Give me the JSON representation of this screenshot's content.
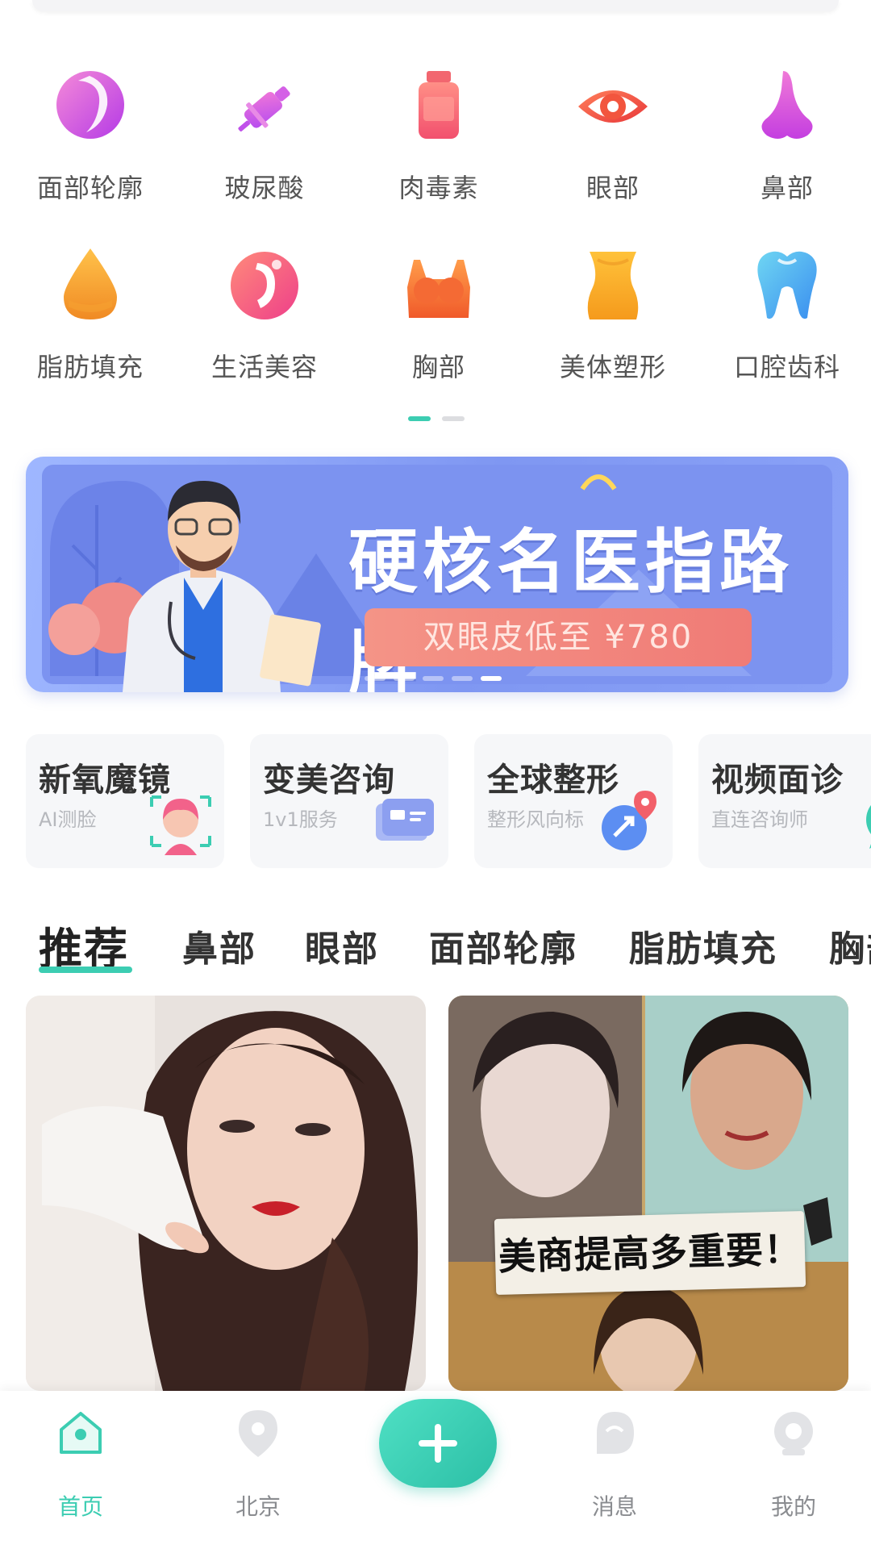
{
  "categories": [
    {
      "label": "面部轮廓",
      "icon": "face-contour-icon"
    },
    {
      "label": "玻尿酸",
      "icon": "syringe-icon"
    },
    {
      "label": "肉毒素",
      "icon": "vial-icon"
    },
    {
      "label": "眼部",
      "icon": "eye-icon"
    },
    {
      "label": "鼻部",
      "icon": "nose-icon"
    },
    {
      "label": "脂肪填充",
      "icon": "fat-drop-icon"
    },
    {
      "label": "生活美容",
      "icon": "beauty-face-icon"
    },
    {
      "label": "胸部",
      "icon": "chest-icon"
    },
    {
      "label": "美体塑形",
      "icon": "body-shape-icon"
    },
    {
      "label": "口腔齿科",
      "icon": "tooth-icon"
    }
  ],
  "pager": {
    "active_index": 0,
    "count": 2
  },
  "banner": {
    "title": "硬核名医指路牌",
    "subtitle": "双眼皮低至 ¥780"
  },
  "quick_cards": [
    {
      "title": "新氧魔镜",
      "subtitle": "AI测脸",
      "icon": "mirror-face-icon"
    },
    {
      "title": "变美咨询",
      "subtitle": "1v1服务",
      "icon": "chat-bubble-icon"
    },
    {
      "title": "全球整形",
      "subtitle": "整形风向标",
      "icon": "globe-pin-icon"
    },
    {
      "title": "视频面诊",
      "subtitle": "直连咨询师",
      "icon": "video-chat-icon"
    }
  ],
  "tabs": [
    {
      "label": "推荐",
      "active": true
    },
    {
      "label": "鼻部",
      "active": false
    },
    {
      "label": "眼部",
      "active": false
    },
    {
      "label": "面部轮廓",
      "active": false
    },
    {
      "label": "脂肪填充",
      "active": false
    },
    {
      "label": "胸部",
      "active": false
    }
  ],
  "feed": [
    {
      "kind": "photo",
      "caption": ""
    },
    {
      "kind": "photo",
      "caption": "美商提高多重要！"
    }
  ],
  "bottom_nav": [
    {
      "label": "首页",
      "icon": "home-icon",
      "active": true
    },
    {
      "label": "北京",
      "icon": "location-pin-icon",
      "active": false
    },
    {
      "label": "",
      "icon": "plus-icon",
      "active": false
    },
    {
      "label": "消息",
      "icon": "message-icon",
      "active": false
    },
    {
      "label": "我的",
      "icon": "profile-icon",
      "active": false
    }
  ],
  "colors": {
    "accent": "#3ccdb2",
    "banner_bg": "#8ea6f6",
    "banner_pill": "#f2857d",
    "text_primary": "#333333",
    "text_muted": "#8a8c90"
  }
}
